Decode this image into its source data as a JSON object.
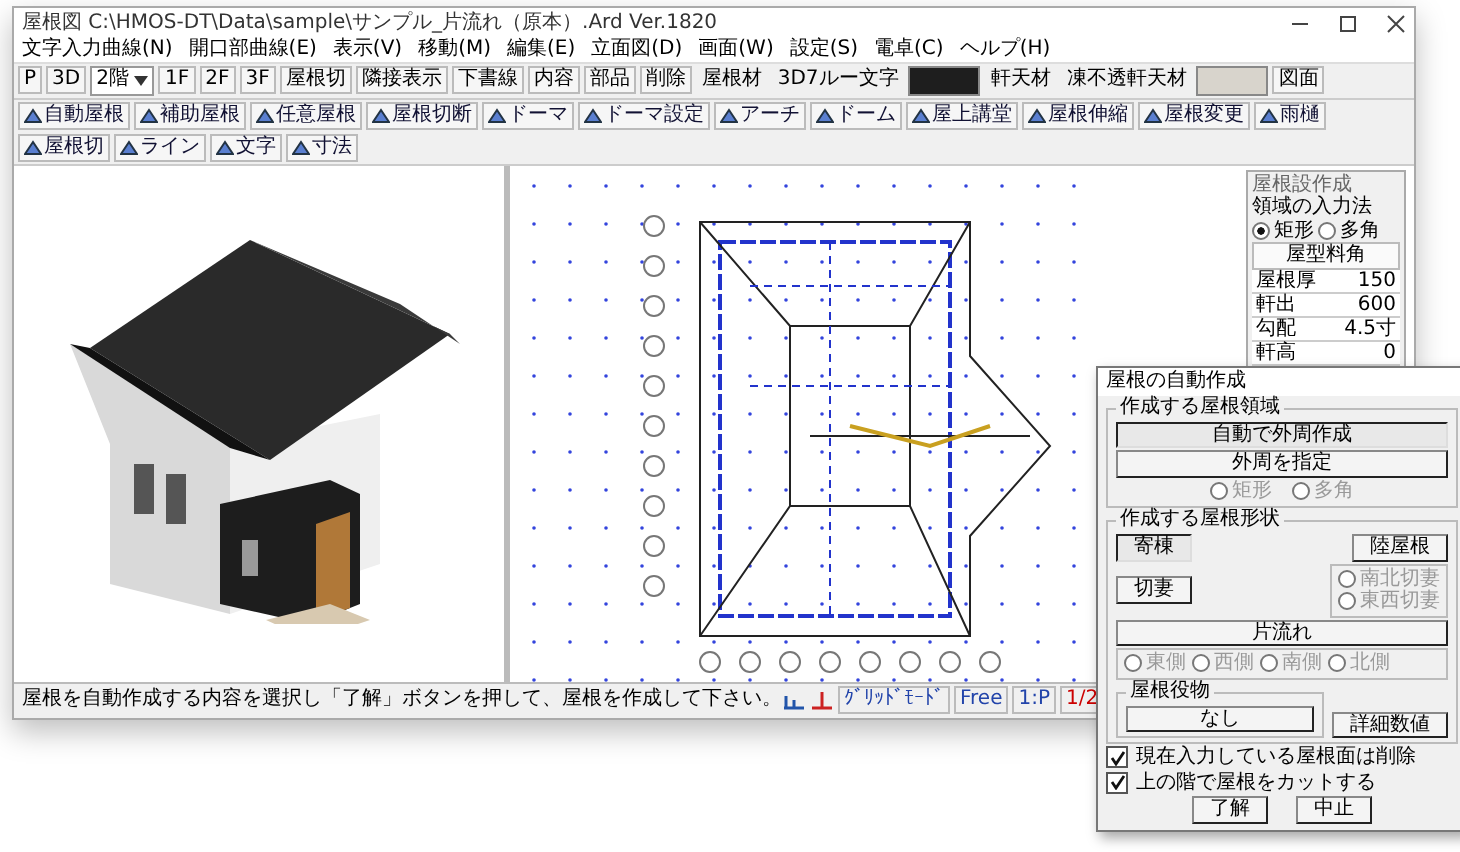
{
  "window": {
    "title": "屋根図 C:\\HMOS-DT\\Data\\sample\\サンプル_片流れ（原本）.Ard Ver.1820"
  },
  "menu": [
    "文字入力曲線(N)",
    "開口部曲線(E)",
    "表示(V)",
    "移動(M)",
    "編集(E)",
    "立面図(D)",
    "画面(W)",
    "設定(S)",
    "電卓(C)",
    "ヘルプ(H)"
  ],
  "toolbar_1": [
    {
      "kind": "button",
      "label": "P"
    },
    {
      "kind": "button",
      "label": "3D"
    },
    {
      "kind": "select",
      "label": "2階"
    },
    {
      "kind": "button",
      "label": "1F"
    },
    {
      "kind": "button",
      "label": "2F"
    },
    {
      "kind": "button",
      "label": "3F"
    },
    {
      "kind": "button",
      "label": "屋根切"
    },
    {
      "kind": "button",
      "label": "隣接表示"
    },
    {
      "kind": "button",
      "label": "下書線"
    },
    {
      "kind": "button",
      "label": "内容"
    },
    {
      "kind": "button",
      "label": "部品"
    },
    {
      "kind": "button",
      "label": "削除"
    },
    {
      "kind": "text",
      "label": "屋根材"
    },
    {
      "kind": "text",
      "label": "3D7ルー文字"
    },
    {
      "kind": "swatch",
      "color": "#1e1e1e"
    },
    {
      "kind": "text",
      "label": "軒天材"
    },
    {
      "kind": "text",
      "label": "凍不透軒天材"
    },
    {
      "kind": "swatch",
      "color": "#d8d4cc"
    },
    {
      "kind": "button",
      "label": "図面"
    }
  ],
  "toolbar_2": [
    "自動屋根",
    "補助屋根",
    "任意屋根",
    "屋根切断",
    "ドーマ",
    "ドーマ設定",
    "アーチ",
    "ドーム",
    "屋上講堂",
    "屋根伸縮",
    "屋根変更",
    "雨樋",
    "屋根切",
    "ライン",
    "文字",
    "寸法"
  ],
  "side_panel": {
    "title": "屋根設作成",
    "input_method": "領域の入力法",
    "radios": [
      {
        "label": "矩形",
        "selected": true
      },
      {
        "label": "多角",
        "selected": false
      }
    ],
    "header": "屋型料角",
    "rows": [
      {
        "label": "屋根厚",
        "value": "150"
      },
      {
        "label": "軒出",
        "value": "600"
      },
      {
        "label": "勾配",
        "value": "4.5寸"
      },
      {
        "label": "軒高",
        "value": "0"
      }
    ]
  },
  "dialog": {
    "title": "屋根の自動作成",
    "area_group": "作成する屋根領域",
    "area_buttons": [
      {
        "label": "自動で外周作成",
        "selected": true
      },
      {
        "label": "外周を指定",
        "selected": false
      }
    ],
    "area_radios": [
      {
        "label": "矩形",
        "disabled": true
      },
      {
        "label": "多角",
        "disabled": true
      }
    ],
    "shape_group": "作成する屋根形状",
    "shape_buttons": [
      {
        "label": "寄棟",
        "selected": true
      },
      {
        "label": "陸屋根",
        "selected": false
      },
      {
        "label": "切妻",
        "selected": false
      },
      {
        "label": "片流れ",
        "selected": false
      }
    ],
    "gable_radios": [
      {
        "label": "南北切妻",
        "disabled": true
      },
      {
        "label": "東西切妻",
        "disabled": true
      }
    ],
    "slope_radios": [
      {
        "label": "東側",
        "disabled": true
      },
      {
        "label": "西側",
        "disabled": true
      },
      {
        "label": "南側",
        "disabled": true
      },
      {
        "label": "北側",
        "disabled": true
      }
    ],
    "trim_group": "屋根役物",
    "trim_button": "なし",
    "detail_button": "詳細数値",
    "checks": [
      {
        "label": "現在入力している屋根面は削除",
        "checked": true
      },
      {
        "label": "上の階で屋根をカットする",
        "checked": true
      }
    ],
    "ok": "了解",
    "cancel": "中止"
  },
  "status_bar": {
    "message": "屋根を自動作成する内容を選択し「了解」ボタンを押して、屋根を作成して下さい。",
    "items": [
      "ｸﾞﾘｯﾄﾞﾓｰﾄﾞ",
      "Free",
      "1:P",
      "1/2"
    ]
  }
}
